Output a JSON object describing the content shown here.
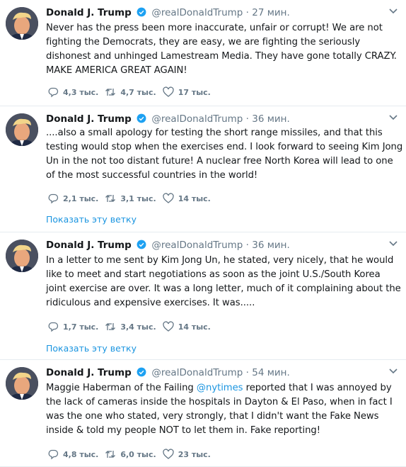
{
  "tweets": [
    {
      "author": "Donald J. Trump",
      "handle": "@realDonaldTrump",
      "separator": "·",
      "time": "27 мин.",
      "text": "Never has the press been more inaccurate, unfair or corrupt! We are not fighting the Democrats, they are easy, we are fighting the seriously dishonest and unhinged Lamestream Media. They have gone totally CRAZY. MAKE AMERICA GREAT AGAIN!",
      "replies": "4,3 тыс.",
      "retweets": "4,7 тыс.",
      "likes": "17 тыс."
    },
    {
      "author": "Donald J. Trump",
      "handle": "@realDonaldTrump",
      "separator": "·",
      "time": "36 мин.",
      "text": "....also a small apology for testing the short range missiles, and that this testing would stop when the exercises end. I look forward to seeing Kim Jong Un in the not too distant future! A nuclear free North Korea will lead to one of the most successful countries in the world!",
      "replies": "2,1 тыс.",
      "retweets": "3,1 тыс.",
      "likes": "14 тыс.",
      "show_thread": "Показать эту ветку"
    },
    {
      "author": "Donald J. Trump",
      "handle": "@realDonaldTrump",
      "separator": "·",
      "time": "36 мин.",
      "text": "In a letter to me sent by Kim Jong Un, he stated, very nicely, that he would like to meet and start negotiations as soon as the joint U.S./South Korea joint exercise are over. It was a long letter, much of it complaining about the ridiculous and expensive exercises. It was.....",
      "replies": "1,7 тыс.",
      "retweets": "3,4 тыс.",
      "likes": "14 тыс.",
      "show_thread": "Показать эту ветку"
    },
    {
      "author": "Donald J. Trump",
      "handle": "@realDonaldTrump",
      "separator": "·",
      "time": "54 мин.",
      "text_before": "Maggie Haberman of the Failing ",
      "mention": "@nytimes",
      "text_after": " reported that I was annoyed by the lack of cameras inside the hospitals in Dayton & El Paso, when in fact I was the one who stated, very strongly, that I didn't want the Fake News inside & told my people NOT to let them in. Fake reporting!",
      "replies": "4,8 тыс.",
      "retweets": "6,0 тыс.",
      "likes": "23 тыс."
    }
  ],
  "colors": {
    "link": "#1b95e0",
    "muted": "#657786",
    "text": "#14171a",
    "divider": "#e6ecf0"
  }
}
